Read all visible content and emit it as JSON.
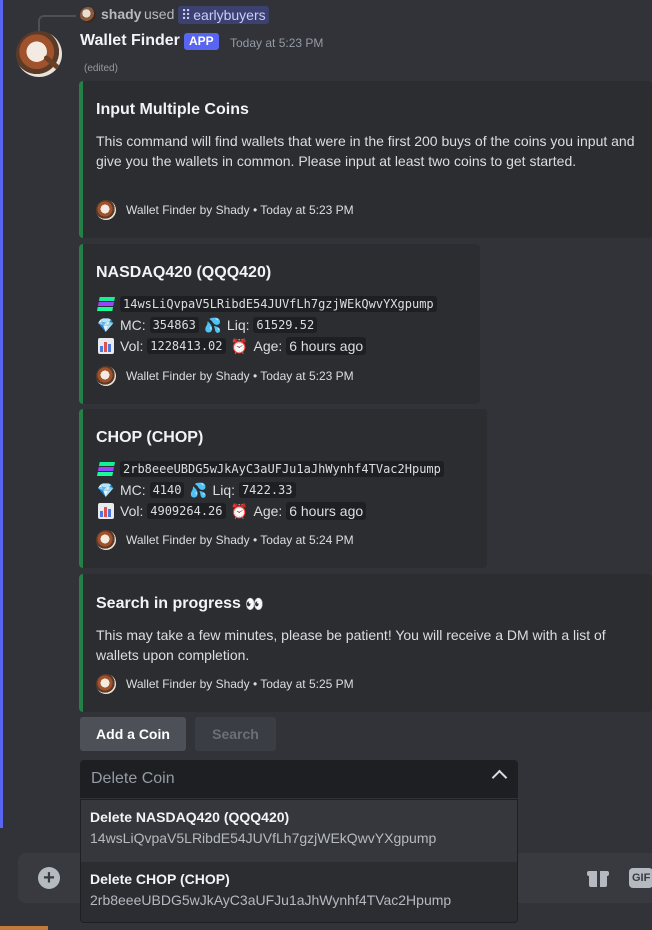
{
  "reply": {
    "username": "shady",
    "used_text": "used",
    "command": "earlybuyers"
  },
  "message": {
    "author": "Wallet Finder",
    "app_tag": "APP",
    "timestamp": "Today at 5:23 PM",
    "edited": "(edited)"
  },
  "embeds": {
    "intro": {
      "title": "Input Multiple Coins",
      "description": "This command will find wallets that were in the first 200 buys of the coins you input and give you the wallets in common. Please input at least two coins to get started.",
      "footer": "Wallet Finder by Shady • Today at 5:23 PM"
    },
    "coin1": {
      "title": "NASDAQ420 (QQQ420)",
      "address": "14wsLiQvpaV5LRibdE54JUVfLh7gzjWEkQwvYXgpump",
      "mc_label": "MC:",
      "mc_value": "354863",
      "liq_label": "Liq:",
      "liq_value": "61529.52",
      "vol_label": "Vol:",
      "vol_value": "1228413.02",
      "age_label": "Age:",
      "age_value": "6 hours ago",
      "footer": "Wallet Finder by Shady • Today at 5:23 PM"
    },
    "coin2": {
      "title": "CHOP (CHOP)",
      "address": "2rb8eeeUBDG5wJkAyC3aUFJu1aJhWynhf4TVac2Hpump",
      "mc_label": "MC:",
      "mc_value": "4140",
      "liq_label": "Liq:",
      "liq_value": "7422.33",
      "vol_label": "Vol:",
      "vol_value": "4909264.26",
      "age_label": "Age:",
      "age_value": "6 hours ago",
      "footer": "Wallet Finder by Shady • Today at 5:24 PM"
    },
    "progress": {
      "title": "Search in progress",
      "description": "This may take a few minutes, please be patient! You will receive a DM with a list of wallets upon completion.",
      "footer": "Wallet Finder by Shady • Today at 5:25 PM"
    }
  },
  "buttons": {
    "add_coin": "Add a Coin",
    "search": "Search"
  },
  "select": {
    "placeholder": "Delete Coin",
    "options": [
      {
        "label": "Delete NASDAQ420 (QQQ420)",
        "description": "14wsLiQvpaV5LRibdE54JUVfLh7gzjWEkQwvYXgpump"
      },
      {
        "label": "Delete CHOP (CHOP)",
        "description": "2rb8eeeUBDG5wJkAyC3aUFJu1aJhWynhf4TVac2Hpump"
      }
    ]
  },
  "composer": {
    "gif_label": "GIF"
  },
  "colors": {
    "embed_border": "#248046",
    "app_tag": "#5865f2",
    "background": "#313338"
  },
  "icons": [
    "solana-icon",
    "gem-icon",
    "droplets-icon",
    "bar-chart-icon",
    "alarm-clock-icon",
    "eyes-emoji",
    "plus-icon",
    "gift-icon",
    "gif-icon",
    "chevron-up-icon"
  ]
}
